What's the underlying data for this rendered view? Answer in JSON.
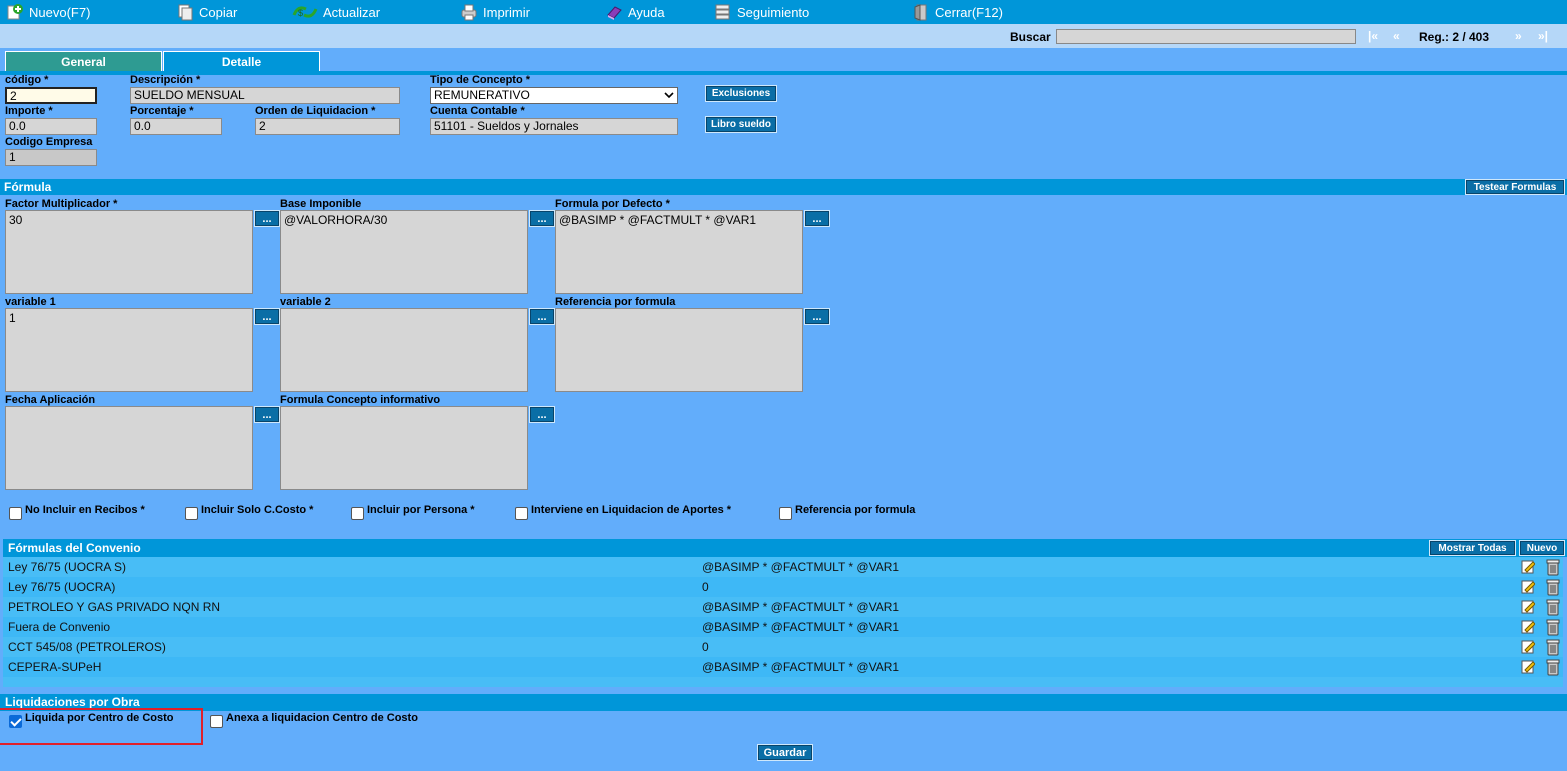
{
  "toolbar": {
    "items": [
      {
        "label": "Nuevo(F7)",
        "icon": "new-icon"
      },
      {
        "label": "Copiar",
        "icon": "copy-icon"
      },
      {
        "label": "Actualizar",
        "icon": "refresh-icon"
      },
      {
        "label": "Imprimir",
        "icon": "print-icon"
      },
      {
        "label": "Ayuda",
        "icon": "help-icon"
      },
      {
        "label": "Seguimiento",
        "icon": "tracking-icon"
      },
      {
        "label": "Cerrar(F12)",
        "icon": "close-icon"
      }
    ]
  },
  "search": {
    "label": "Buscar",
    "value": "",
    "first": "|«",
    "prev": "«",
    "reg": "Reg.: 2 / 403",
    "next": "»",
    "last": "»|"
  },
  "tabs": {
    "general": "General",
    "detalle": "Detalle",
    "active": "General"
  },
  "general": {
    "codigo": {
      "label": "código *",
      "value": "2"
    },
    "descripcion": {
      "label": "Descripción *",
      "value": "SUELDO MENSUAL"
    },
    "tipo": {
      "label": "Tipo de Concepto *",
      "value": "REMUNERATIVO"
    },
    "exclusiones": "Exclusiones",
    "importe": {
      "label": "Importe *",
      "value": "0.0"
    },
    "porcentaje": {
      "label": "Porcentaje *",
      "value": "0.0"
    },
    "orden": {
      "label": "Orden de Liquidacion *",
      "value": "2"
    },
    "cuenta": {
      "label": "Cuenta Contable *",
      "value": "51101 - Sueldos y Jornales"
    },
    "libro": "Libro sueldo",
    "empresa": {
      "label": "Codigo Empresa",
      "value": "1"
    }
  },
  "formula": {
    "title": "Fórmula",
    "test_button": "Testear Formulas",
    "dots": "...",
    "factor": {
      "label": "Factor Multiplicador *",
      "value": "30"
    },
    "base": {
      "label": "Base Imponible",
      "value": "@VALORHORA/30"
    },
    "defecto": {
      "label": "Formula por Defecto *",
      "value": "@BASIMP * @FACTMULT * @VAR1"
    },
    "var1": {
      "label": "variable 1",
      "value": "1"
    },
    "var2": {
      "label": "variable 2",
      "value": ""
    },
    "ref": {
      "label": "Referencia por formula",
      "value": ""
    },
    "fecha": {
      "label": "Fecha Aplicación",
      "value": ""
    },
    "info": {
      "label": "Formula Concepto informativo",
      "value": ""
    }
  },
  "checks": [
    {
      "label": "No Incluir en Recibos *",
      "checked": false
    },
    {
      "label": "Incluir Solo C.Costo *",
      "checked": false
    },
    {
      "label": "Incluir por Persona *",
      "checked": false
    },
    {
      "label": "Interviene en Liquidacion de Aportes *",
      "checked": false
    },
    {
      "label": "Referencia por formula",
      "checked": false
    }
  ],
  "convenio": {
    "title": "Fórmulas del Convenio",
    "show_all": "Mostrar Todas",
    "new": "Nuevo",
    "rows": [
      {
        "name": "Ley 76/75 (UOCRA S)",
        "formula": "@BASIMP * @FACTMULT * @VAR1"
      },
      {
        "name": "Ley 76/75 (UOCRA)",
        "formula": "0"
      },
      {
        "name": "PETROLEO Y GAS PRIVADO NQN RN",
        "formula": "@BASIMP * @FACTMULT * @VAR1"
      },
      {
        "name": "Fuera de Convenio",
        "formula": "@BASIMP * @FACTMULT * @VAR1"
      },
      {
        "name": "CCT 545/08 (PETROLEROS)",
        "formula": "0"
      },
      {
        "name": "CEPERA-SUPeH",
        "formula": "@BASIMP * @FACTMULT * @VAR1"
      }
    ]
  },
  "obra": {
    "title": "Liquidaciones por Obra",
    "liquida": {
      "label": "Liquida por Centro de Costo",
      "checked": true
    },
    "anexa": {
      "label": "Anexa a liquidacion Centro de Costo",
      "checked": false
    },
    "save": "Guardar"
  },
  "colors": {
    "toolbar": "#0096d9",
    "body": "#62adfb",
    "band": "#0096d9",
    "row_a": "#48bdf6",
    "row_b": "#3eb8f6",
    "highlight": "#e0202a"
  }
}
